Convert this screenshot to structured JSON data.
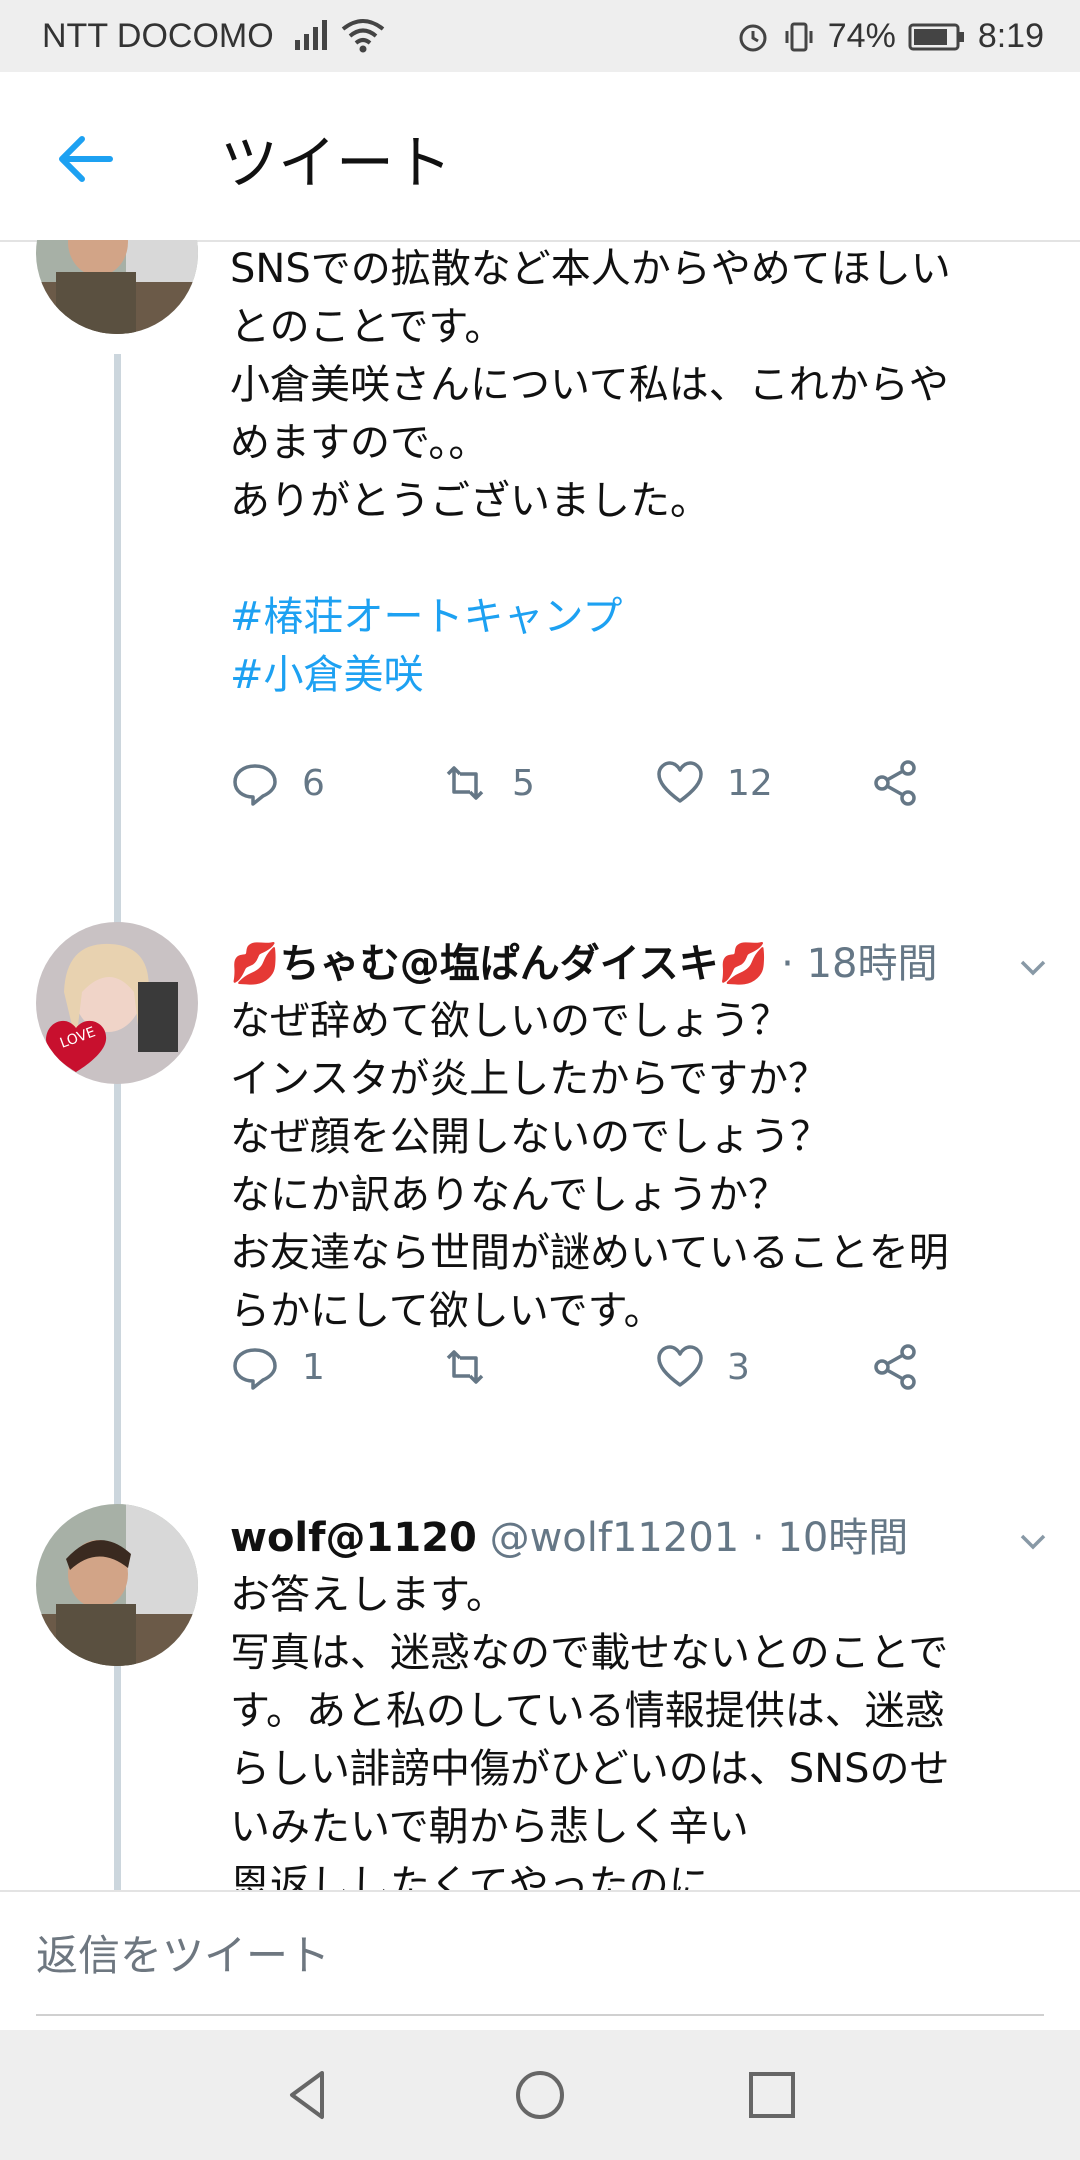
{
  "status_bar": {
    "carrier": "NTT DOCOMO",
    "battery": "74%",
    "time": "8:19"
  },
  "header": {
    "title": "ツイート"
  },
  "tweets": [
    {
      "text": "SNSでの拡散など本人からやめてほしい\nとのことです。\n小倉美咲さんについて私は、これからや\nめますので。。\nありがとうございました。",
      "hashtags": [
        "#椿荘オートキャンプ",
        "#小倉美咲"
      ],
      "replies": "6",
      "retweets": "5",
      "likes": "12"
    },
    {
      "name": "💋ちゃむ@塩ぱんダイスキ💋",
      "meta": " · 18時間",
      "text": "なぜ辞めて欲しいのでしょう？\nインスタが炎上したからですか？\nなぜ顔を公開しないのでしょう？\nなにか訳ありなんでしょうか？\nお友達なら世間が謎めいていることを明\nらかにして欲しいです。",
      "replies": "1",
      "retweets": "",
      "likes": "3"
    },
    {
      "name": "wolf@1120",
      "meta": " @wolf11201 · 10時間",
      "text": "お答えします。\n写真は、迷惑なので載せないとのことで\nす。あと私のしている情報提供は、迷惑\nらしい誹謗中傷がひどいのは、SNSのせ\nいみたいで朝から悲しく辛い\n恩返ししたくてやったのに"
    }
  ],
  "reply_bar": {
    "placeholder": "返信をツイート"
  },
  "colors": {
    "accent": "#1da1f2",
    "thread_line": "#ccd6dd",
    "muted": "#657786"
  },
  "icons": [
    "back-arrow-icon",
    "reply-icon",
    "retweet-icon",
    "like-icon",
    "share-icon",
    "chevron-down-icon"
  ]
}
